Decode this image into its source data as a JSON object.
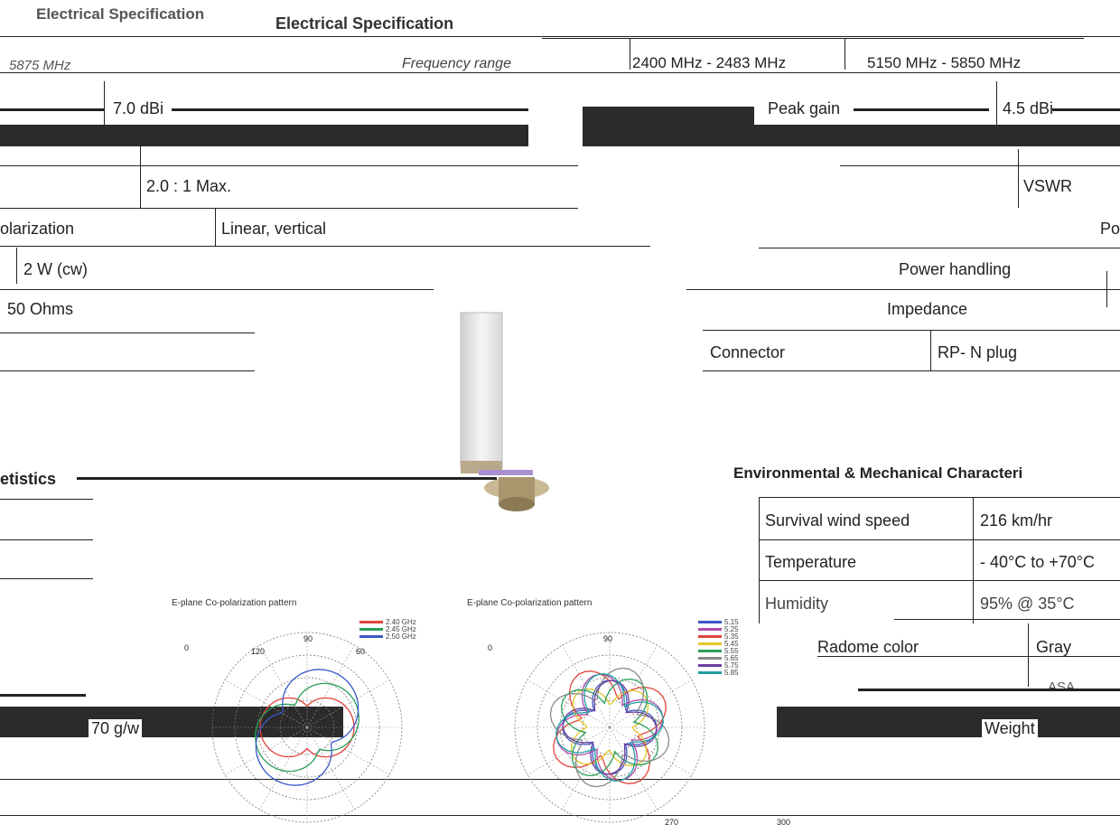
{
  "electrical": {
    "title_ghost": "Electrical Specification",
    "title": "Electrical Specification",
    "frequency_label": "Frequency range",
    "frequency_ranges": [
      "2400 MHz - 2483 MHz",
      "5150 MHz - 5850 MHz"
    ],
    "freq_left_fragment": "5875 MHz",
    "freq_center_fragment": "2400 MHz - 2483 MHz",
    "gain_left_value": "7.0 dBi",
    "peak_gain_label": "Peak gain",
    "peak_gain_value": "4.5 dBi",
    "vswr_value": "2.0 : 1 Max.",
    "vswr_label": "VSWR",
    "polarization_label": "olarization",
    "polarization_value": "Linear, vertical",
    "polarization_label_right": "Po",
    "power_value": "2 W (cw)",
    "power_label": "Power handling",
    "impedance_value": "50 Ohms",
    "impedance_label": "Impedance",
    "connector_label": "Connector",
    "connector_value": "RP- N plug"
  },
  "environmental": {
    "left_fragment": "etistics",
    "title": "Environmental & Mechanical Characteri",
    "rows": [
      {
        "label": "Survival wind speed",
        "value": "216 km/hr"
      },
      {
        "label": "Temperature",
        "value": "- 40°C to +70°C"
      },
      {
        "label": "Humidity",
        "value": "95% @ 35°C"
      }
    ],
    "radome_color_label": "Radome color",
    "radome_color_value": "Gray",
    "radome_material_fragment": "ASA",
    "weight_left_value": "70 g/w",
    "weight_label": "Weight"
  },
  "plots": {
    "left_title": "E-plane Co-polarization pattern",
    "right_title": "E-plane Co-polarization pattern",
    "left_legend": [
      {
        "label": "2.40 GHz",
        "color": "#e0453a"
      },
      {
        "label": "2.45 GHz",
        "color": "#2aa05a"
      },
      {
        "label": "2.50 GHz",
        "color": "#3a57c8"
      }
    ],
    "right_legend": [
      {
        "label": "5.15",
        "color": "#3a57c8"
      },
      {
        "label": "5.25",
        "color": "#b04ab0"
      },
      {
        "label": "5.35",
        "color": "#e0453a"
      },
      {
        "label": "5.45",
        "color": "#e3c62b"
      },
      {
        "label": "5.55",
        "color": "#2aa05a"
      },
      {
        "label": "5.65",
        "color": "#8a8a8a"
      },
      {
        "label": "5.75",
        "color": "#6b3fa0"
      },
      {
        "label": "5.85",
        "color": "#20a0a0"
      }
    ],
    "angle_90": "90",
    "angle_120": "120",
    "angle_60": "60",
    "angle_270": "270",
    "angle_300": "300",
    "axis_0": "0"
  }
}
